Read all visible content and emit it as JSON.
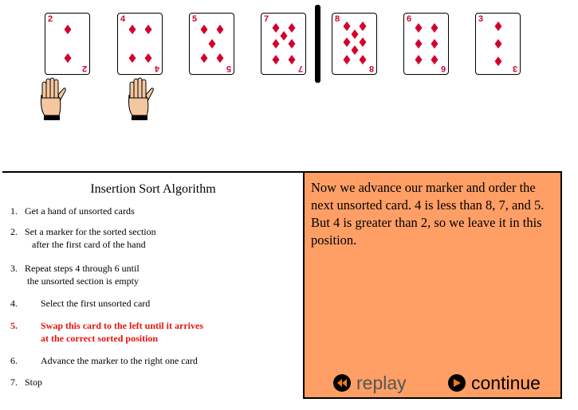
{
  "cards": [
    {
      "rank": "2",
      "pips": 2
    },
    {
      "rank": "4",
      "pips": 4
    },
    {
      "rank": "5",
      "pips": 5
    },
    {
      "rank": "7",
      "pips": 7
    },
    {
      "rank": "8",
      "pips": 8
    },
    {
      "rank": "6",
      "pips": 6
    },
    {
      "rank": "3",
      "pips": 3
    }
  ],
  "suit_color": "#d4002a",
  "panel_bg": "#ff9f66",
  "algorithm": {
    "title": "Insertion Sort Algorithm",
    "steps": [
      {
        "num": "1.",
        "text": "Get a hand of unsorted cards"
      },
      {
        "num": "2.",
        "text": "Set a marker for the sorted section\n   after the first card of the hand"
      },
      {
        "num": "3.",
        "text": "Repeat steps 4 through 6 until\n the unsorted section is empty"
      },
      {
        "num": "4.",
        "text": "Select the first unsorted card"
      },
      {
        "num": "5.",
        "text": "Swap this card to the left until it arrives\nat the correct sorted position"
      },
      {
        "num": "6.",
        "text": "Advance the marker to the right one card"
      },
      {
        "num": "7.",
        "text": "Stop"
      }
    ]
  },
  "explanation": "Now we advance our marker and order the next unsorted card.  4 is less than 8, 7, and 5.  But 4 is greater than 2, so we leave it in this position.",
  "controls": {
    "replay": "replay",
    "continue": "continue"
  }
}
